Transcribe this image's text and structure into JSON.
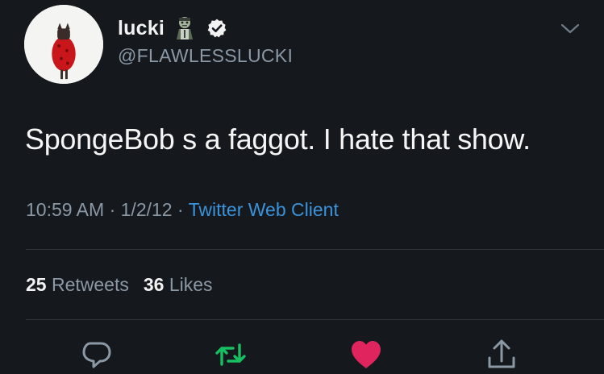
{
  "tweet": {
    "display_name": "lucki",
    "handle": "@FLAWLESSLUCKI",
    "text": "SpongeBob s a faggot. I hate that show.",
    "time": "10:59 AM",
    "separator": "·",
    "date": "1/2/12",
    "client": "Twitter Web Client"
  },
  "stats": {
    "retweets_count": "25",
    "retweets_label": "Retweets",
    "likes_count": "36",
    "likes_label": "Likes"
  },
  "icons": {
    "name_emoji": "zombie-emoji-icon",
    "verified": "verified-badge-icon",
    "menu": "chevron-down-icon",
    "reply": "reply-icon",
    "retweet": "retweet-icon",
    "like": "heart-icon",
    "share": "share-icon"
  },
  "colors": {
    "background": "#15181c",
    "link": "#3b93db",
    "retweet": "#17bf63",
    "like": "#e0245e",
    "muted": "#8b98a5"
  }
}
